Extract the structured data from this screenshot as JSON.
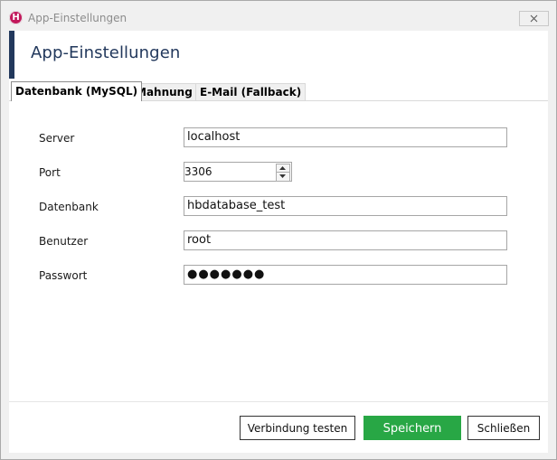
{
  "window": {
    "title": "App-Einstellungen",
    "icon_letter": "H",
    "icon": "app-logo-icon",
    "close_icon": "close-icon"
  },
  "header": {
    "title": "App-Einstellungen",
    "accent_color": "#22385c"
  },
  "tabs": [
    {
      "label": "Datenbank (MySQL)",
      "active": true
    },
    {
      "label": "Mahnung",
      "active": false
    },
    {
      "label": "E-Mail (Fallback)",
      "active": false
    }
  ],
  "form": {
    "server": {
      "label": "Server",
      "value": "localhost"
    },
    "port": {
      "label": "Port",
      "value": "3306"
    },
    "database": {
      "label": "Datenbank",
      "value": "hbdatabase_test"
    },
    "user": {
      "label": "Benutzer",
      "value": "root"
    },
    "password": {
      "label": "Passwort",
      "value": "●●●●●●●"
    }
  },
  "buttons": {
    "test": "Verbindung testen",
    "save": "Speichern",
    "close": "Schließen",
    "save_color": "#28a745"
  }
}
